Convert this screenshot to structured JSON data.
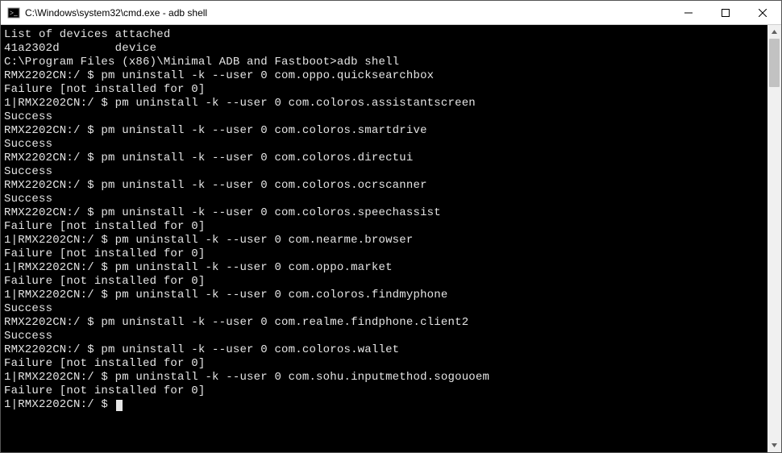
{
  "window": {
    "title": "C:\\Windows\\system32\\cmd.exe - adb  shell"
  },
  "terminal": {
    "lines": [
      "List of devices attached",
      "41a2302d        device",
      "",
      "",
      "C:\\Program Files (x86)\\Minimal ADB and Fastboot>adb shell",
      "RMX2202CN:/ $ pm uninstall -k --user 0 com.oppo.quicksearchbox",
      "Failure [not installed for 0]",
      "1|RMX2202CN:/ $ pm uninstall -k --user 0 com.coloros.assistantscreen",
      "Success",
      "RMX2202CN:/ $ pm uninstall -k --user 0 com.coloros.smartdrive",
      "Success",
      "RMX2202CN:/ $ pm uninstall -k --user 0 com.coloros.directui",
      "Success",
      "RMX2202CN:/ $ pm uninstall -k --user 0 com.coloros.ocrscanner",
      "Success",
      "RMX2202CN:/ $ pm uninstall -k --user 0 com.coloros.speechassist",
      "Failure [not installed for 0]",
      "1|RMX2202CN:/ $ pm uninstall -k --user 0 com.nearme.browser",
      "Failure [not installed for 0]",
      "1|RMX2202CN:/ $ pm uninstall -k --user 0 com.oppo.market",
      "Failure [not installed for 0]",
      "1|RMX2202CN:/ $ pm uninstall -k --user 0 com.coloros.findmyphone",
      "Success",
      "RMX2202CN:/ $ pm uninstall -k --user 0 com.realme.findphone.client2",
      "Success",
      "RMX2202CN:/ $ pm uninstall -k --user 0 com.coloros.wallet",
      "Failure [not installed for 0]",
      "1|RMX2202CN:/ $ pm uninstall -k --user 0 com.sohu.inputmethod.sogouoem",
      "Failure [not installed for 0]",
      "1|RMX2202CN:/ $ "
    ]
  }
}
